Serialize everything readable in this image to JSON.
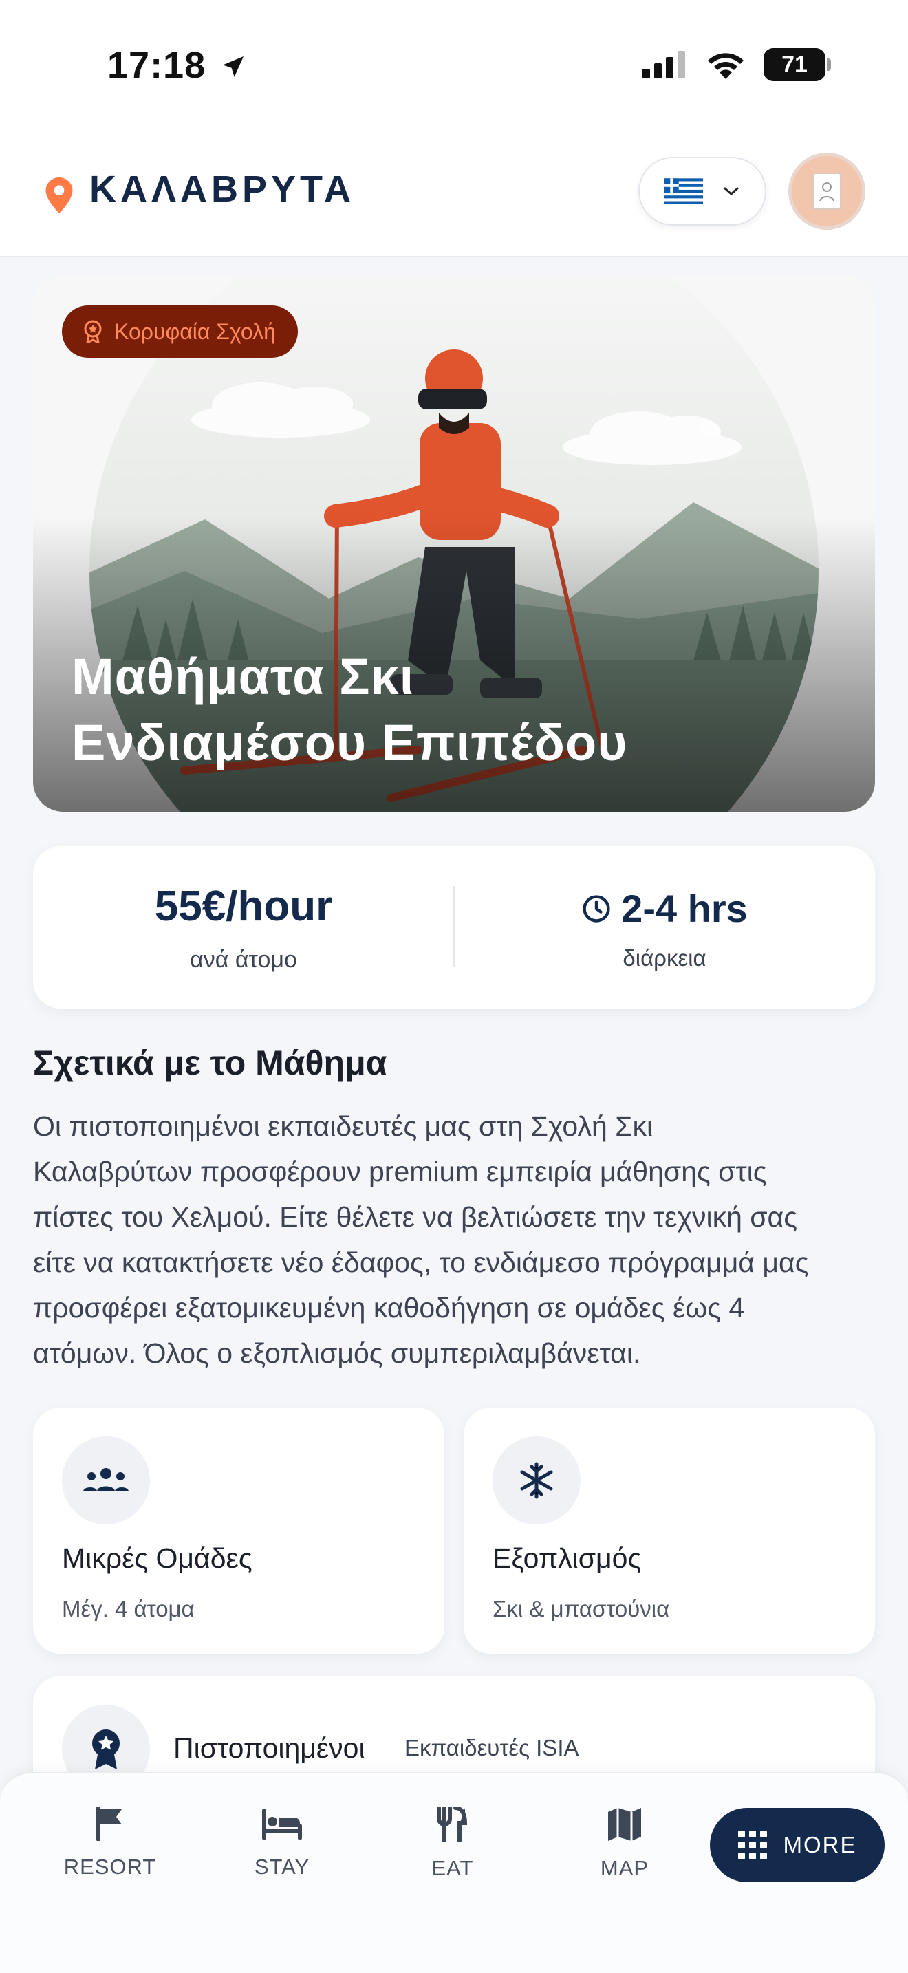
{
  "status_bar": {
    "time": "17:18",
    "battery": "71"
  },
  "header": {
    "location": "ΚΑΛΑΒΡΥΤΑ",
    "language_flag": "greek-flag-icon"
  },
  "hero": {
    "badge": "Κορυφαία Σχολή",
    "title_line1": "Μαθήματα Σκι",
    "title_line2": "Ενδιαμέσου Επιπέδου"
  },
  "pricing": {
    "price": "55€/hour",
    "price_sub": "ανά άτομο",
    "duration": "2-4 hrs",
    "duration_sub": "διάρκεια"
  },
  "about": {
    "heading": "Σχετικά με το Μάθημα",
    "lines": [
      "Οι πιστοποιημένοι εκπαιδευτές μας στη Σχολή Σκι",
      "Καλαβρύτων προσφέρουν premium εμπειρία μάθησης στις",
      "πίστες του Χελμού. Είτε θέλετε να βελτιώσετε την τεχνική σας",
      "είτε να κατακτήσετε νέο έδαφος, το ενδιάμεσο πρόγραμμά μας",
      "προσφέρει εξατομικευμένη καθοδήγηση σε ομάδες έως 4",
      "ατόμων. Όλος ο εξοπλισμός συμπεριλαμβάνεται."
    ]
  },
  "features": [
    {
      "title": "Μικρές Ομάδες",
      "subtitle": "Μέγ. 4 άτομα",
      "icon": "group-icon"
    },
    {
      "title": "Εξοπλισμός",
      "subtitle": "Σκι & μπαστούνια",
      "icon": "snowflake-icon"
    }
  ],
  "certified": {
    "title": "Πιστοποιημένοι",
    "subtitle": "Εκπαιδευτές ISIA",
    "icon": "award-icon"
  },
  "bottom_nav": {
    "items": [
      {
        "label": "RESORT",
        "icon": "flag-icon"
      },
      {
        "label": "STAY",
        "icon": "bed-icon"
      },
      {
        "label": "EAT",
        "icon": "restaurant-icon"
      },
      {
        "label": "MAP",
        "icon": "map-icon"
      }
    ],
    "more_label": "MORE"
  },
  "colors": {
    "navy": "#132a4d",
    "accent_orange": "#ff7a45",
    "badge_bg": "#7b1e08"
  }
}
